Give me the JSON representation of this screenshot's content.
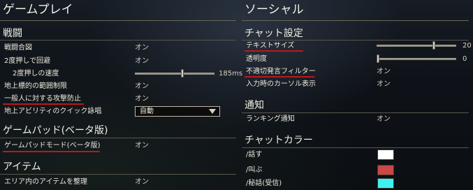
{
  "left": {
    "title": "ゲームプレイ",
    "sections": [
      {
        "header": "戦闘",
        "rows": [
          {
            "label": "戦闘合図",
            "value": "オン"
          },
          {
            "label": "2度押しで回避",
            "value": "オン"
          },
          {
            "label": "2度押しの速度",
            "value": "185ms",
            "slider_level": 0.6
          },
          {
            "label": "地上標的の範囲制限",
            "value": "オン"
          },
          {
            "label": "一般人に対する攻撃防止",
            "value": "オン"
          },
          {
            "label": "地上アビリティのクイック詠唱",
            "dropdown": "自動"
          }
        ]
      },
      {
        "header": "ゲームパッド(ベータ版)",
        "rows": [
          {
            "label": "ゲームパッドモード(ベータ版)",
            "value": "オン"
          }
        ]
      },
      {
        "header": "アイテム",
        "rows": [
          {
            "label": "エリア内のアイテムを整理",
            "value": "オン"
          }
        ]
      }
    ]
  },
  "right": {
    "title": "ソーシャル",
    "sections": [
      {
        "header": "チャット設定",
        "rows": [
          {
            "label": "テキストサイズ",
            "value": "20",
            "slider_level": 0.73
          },
          {
            "label": "透明度",
            "value": "0",
            "slider_level": 0.0
          },
          {
            "label": "不適切発言フィルター",
            "value": "オン"
          },
          {
            "label": "入力時のカーソル表示",
            "value": "オン"
          }
        ]
      },
      {
        "header": "通知",
        "rows": [
          {
            "label": "ランキング通知",
            "value": "オン"
          }
        ]
      },
      {
        "header": "チャットカラー",
        "rows": [
          {
            "label": "/話す",
            "color": "#ffffff"
          },
          {
            "label": "/叫ぶ",
            "color": "#c94845"
          },
          {
            "label": "/秘話(受信)",
            "color": "#3ff1f0"
          }
        ]
      }
    ]
  },
  "colors": {
    "highlight_underline": "#c0161c",
    "value_text": "#d6d0bf"
  }
}
